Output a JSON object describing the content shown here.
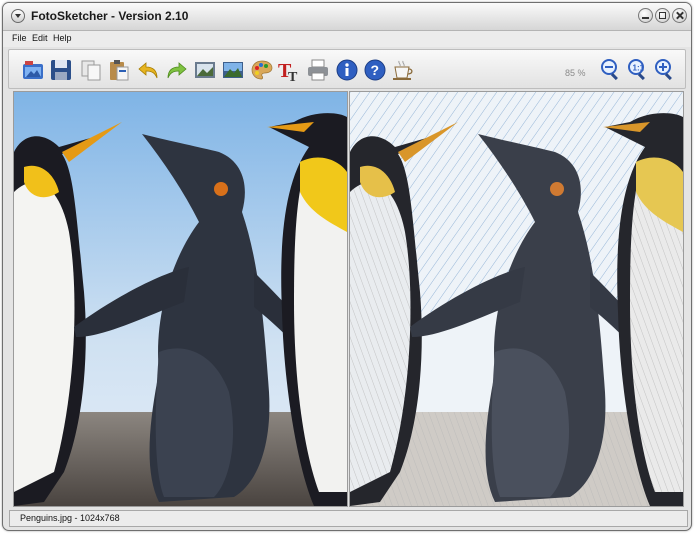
{
  "window": {
    "title": "FotoSketcher - Version 2.10"
  },
  "menu": {
    "file": "File",
    "edit": "Edit",
    "help": "Help"
  },
  "toolbar": {
    "zoom_level": "85 %",
    "buttons": [
      "open-icon",
      "save-icon",
      "copy-icon",
      "paste-icon",
      "undo-icon",
      "redo-icon",
      "batch-icon",
      "landscape-icon",
      "palette-icon",
      "text-icon",
      "print-icon",
      "info-icon",
      "help-icon",
      "coffee-icon",
      "zoom-out-icon",
      "zoom-actual-icon",
      "zoom-in-icon"
    ]
  },
  "images": {
    "original": "original-photo-penguins",
    "sketch": "pencil-sketch-penguins"
  },
  "status": {
    "text": "Penguins.jpg - 1024x768"
  }
}
